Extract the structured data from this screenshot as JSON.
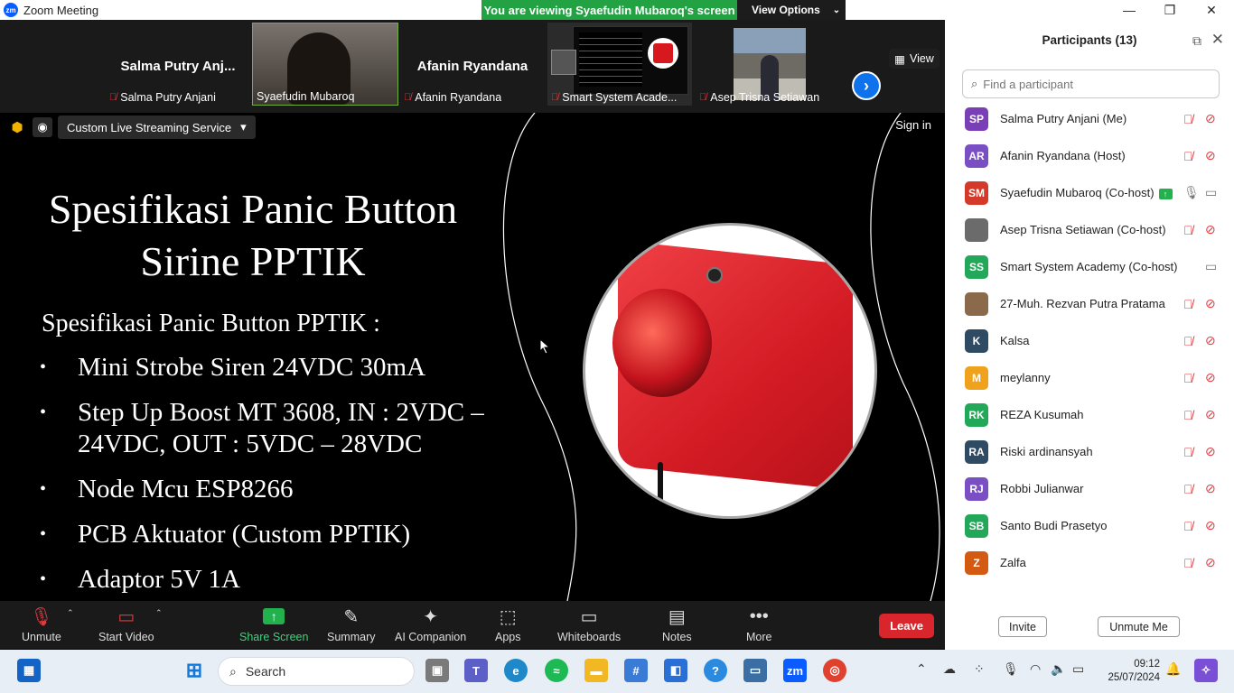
{
  "window": {
    "title": "Zoom Meeting",
    "logo_text": "zm"
  },
  "banner": {
    "viewing_text": "You are viewing Syaefudin Mubaroq's screen",
    "view_options_label": "View Options"
  },
  "strip": {
    "tiles": [
      {
        "big_name": "Salma  Putry  Anj...",
        "label": "Salma Putry Anjani"
      },
      {
        "label": "Syaefudin Mubaroq"
      },
      {
        "big_name": "Afanin Ryandana",
        "label": "Afanin Ryandana"
      },
      {
        "label": "Smart System Acade..."
      },
      {
        "label": "Asep Trisna Setiawan"
      }
    ],
    "view_label": "View"
  },
  "share": {
    "stream_label": "Custom Live Streaming Service",
    "sign_in": "Sign in",
    "slide": {
      "title_line1": "Spesifikasi Panic Button",
      "title_line2": "Sirine PPTIK",
      "intro": "Spesifikasi Panic Button PPTIK :",
      "items": [
        "Mini Strobe Siren 24VDC 30mA",
        "Step Up Boost MT 3608, IN : 2VDC – 24VDC, OUT : 5VDC – 28VDC",
        "Node Mcu ESP8266",
        "PCB Aktuator (Custom PPTIK)",
        "Adaptor 5V 1A"
      ]
    }
  },
  "controls": {
    "unmute": "Unmute",
    "start_video": "Start Video",
    "share_screen": "Share Screen",
    "summary": "Summary",
    "ai_companion": "AI Companion",
    "apps": "Apps",
    "whiteboards": "Whiteboards",
    "notes": "Notes",
    "more": "More",
    "leave": "Leave"
  },
  "participants": {
    "title": "Participants (13)",
    "search_placeholder": "Find a participant",
    "list": [
      {
        "initials": "SP",
        "name": "Salma Putry Anjani (Me)",
        "color": "#7a3fb6",
        "mic": "muted",
        "cam": "off"
      },
      {
        "initials": "AR",
        "name": "Afanin Ryandana (Host)",
        "color": "#7b4fc4",
        "mic": "muted",
        "cam": "off"
      },
      {
        "initials": "SM",
        "name": "Syaefudin Mubaroq (Co-host)",
        "color": "#d43a2a",
        "mic": "on",
        "cam": "on",
        "sharing": true
      },
      {
        "initials": "",
        "name": "Asep Trisna Setiawan (Co-host)",
        "color": "#6b6b6b",
        "mic": "muted",
        "cam": "off"
      },
      {
        "initials": "SS",
        "name": "Smart System Academy (Co-host)",
        "color": "#23a85a",
        "mic": "none",
        "cam": "on"
      },
      {
        "initials": "",
        "name": "27-Muh. Rezvan Putra Pratama",
        "color": "#8a6a4a",
        "mic": "muted",
        "cam": "off"
      },
      {
        "initials": "K",
        "name": "Kalsa",
        "color": "#2f4a63",
        "mic": "muted",
        "cam": "off"
      },
      {
        "initials": "M",
        "name": "meylanny",
        "color": "#f0a21c",
        "mic": "muted",
        "cam": "off"
      },
      {
        "initials": "RK",
        "name": "REZA Kusumah",
        "color": "#23a85a",
        "mic": "muted",
        "cam": "off"
      },
      {
        "initials": "RA",
        "name": "Riski ardinansyah",
        "color": "#2f4a63",
        "mic": "muted",
        "cam": "off"
      },
      {
        "initials": "RJ",
        "name": "Robbi Julianwar",
        "color": "#7b4fc4",
        "mic": "muted",
        "cam": "off"
      },
      {
        "initials": "SB",
        "name": "Santo Budi Prasetyo",
        "color": "#23a85a",
        "mic": "muted",
        "cam": "off"
      },
      {
        "initials": "Z",
        "name": "Zalfa",
        "color": "#d45a12",
        "mic": "muted",
        "cam": "off"
      }
    ],
    "invite": "Invite",
    "unmute_me": "Unmute Me"
  },
  "taskbar": {
    "search_label": "Search",
    "time": "09:12",
    "date": "25/07/2024"
  },
  "colors": {
    "accent": "#0e72ed",
    "share_green": "#23a244",
    "leave_red": "#d9262d"
  }
}
